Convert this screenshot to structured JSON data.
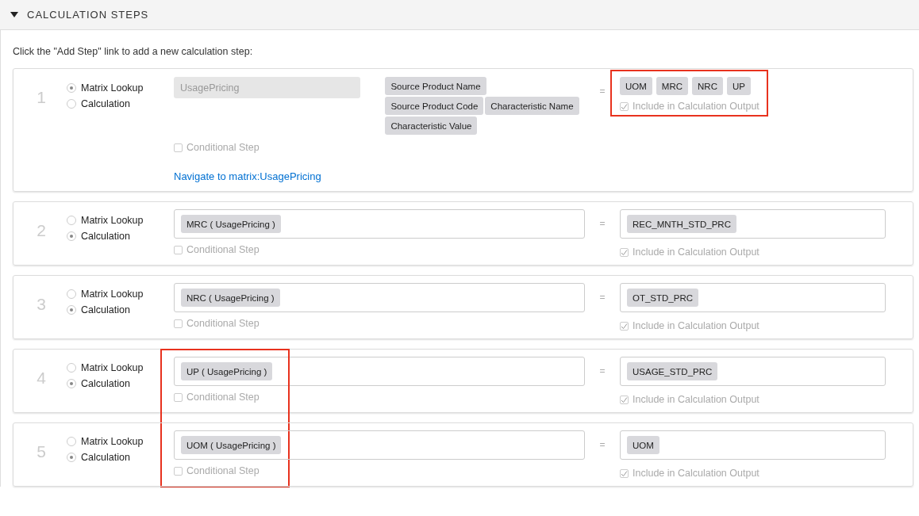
{
  "section": {
    "title": "CALCULATION STEPS",
    "expanded": true
  },
  "instruction": "Click the \"Add Step\" link to add a new calculation step:",
  "steps": [
    {
      "number": "1",
      "kind": "lookup",
      "options": [
        {
          "label": "Matrix Lookup",
          "selected": true
        },
        {
          "label": "Calculation",
          "selected": false
        }
      ],
      "matrix": "UsagePricing",
      "inputs": [
        "Source Product Name",
        "Source Product Code",
        "Characteristic Name",
        "Characteristic Value"
      ],
      "equals": "=",
      "outputs": [
        "UOM",
        "MRC",
        "NRC",
        "UP"
      ],
      "output_highlighted": true,
      "formula_highlighted": false,
      "conditional": {
        "label": "Conditional Step",
        "checked": false
      },
      "include": {
        "label": "Include in Calculation Output",
        "checked": true
      },
      "link": "Navigate to matrix:UsagePricing"
    },
    {
      "number": "2",
      "kind": "calculation",
      "options": [
        {
          "label": "Matrix Lookup",
          "selected": false
        },
        {
          "label": "Calculation",
          "selected": true
        }
      ],
      "formula": [
        "MRC ( UsagePricing )"
      ],
      "equals": "=",
      "outputs": [
        "REC_MNTH_STD_PRC"
      ],
      "output_highlighted": false,
      "formula_highlighted": false,
      "conditional": {
        "label": "Conditional Step",
        "checked": false
      },
      "include": {
        "label": "Include in Calculation Output",
        "checked": true
      }
    },
    {
      "number": "3",
      "kind": "calculation",
      "options": [
        {
          "label": "Matrix Lookup",
          "selected": false
        },
        {
          "label": "Calculation",
          "selected": true
        }
      ],
      "formula": [
        "NRC ( UsagePricing )"
      ],
      "equals": "=",
      "outputs": [
        "OT_STD_PRC"
      ],
      "output_highlighted": false,
      "formula_highlighted": false,
      "conditional": {
        "label": "Conditional Step",
        "checked": false
      },
      "include": {
        "label": "Include in Calculation Output",
        "checked": true
      }
    },
    {
      "number": "4",
      "kind": "calculation",
      "options": [
        {
          "label": "Matrix Lookup",
          "selected": false
        },
        {
          "label": "Calculation",
          "selected": true
        }
      ],
      "formula": [
        "UP ( UsagePricing )"
      ],
      "equals": "=",
      "outputs": [
        "USAGE_STD_PRC"
      ],
      "output_highlighted": false,
      "formula_highlighted": true,
      "conditional": {
        "label": "Conditional Step",
        "checked": false
      },
      "include": {
        "label": "Include in Calculation Output",
        "checked": true
      }
    },
    {
      "number": "5",
      "kind": "calculation",
      "options": [
        {
          "label": "Matrix Lookup",
          "selected": false
        },
        {
          "label": "Calculation",
          "selected": true
        }
      ],
      "formula": [
        "UOM ( UsagePricing )"
      ],
      "equals": "=",
      "outputs": [
        "UOM"
      ],
      "output_highlighted": false,
      "formula_highlighted": true,
      "conditional": {
        "label": "Conditional Step",
        "checked": false
      },
      "include": {
        "label": "Include in Calculation Output",
        "checked": true
      }
    }
  ]
}
